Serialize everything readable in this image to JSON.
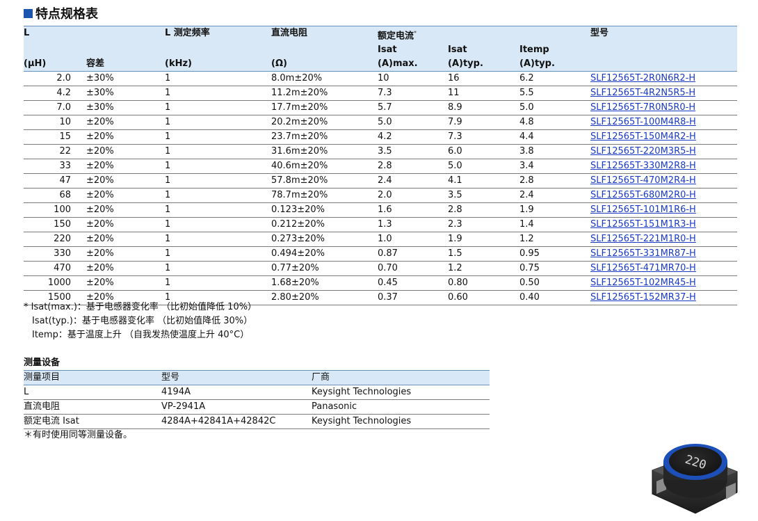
{
  "title": "特点规格表",
  "spec_table": {
    "headers": {
      "L_top": "L",
      "freq": "L 测定频率",
      "dcr": "直流电阻",
      "rated": "额定电流",
      "rated_mark": "*",
      "part": "型号",
      "isat_max_top": "Isat",
      "isat_typ_top": "Isat",
      "itemp_top": "Itemp",
      "L_unit": "(μH)",
      "tol": "容差",
      "freq_unit": "(kHz)",
      "dcr_unit": "(Ω)",
      "isat_max_unit": "(A)max.",
      "isat_typ_unit": "(A)typ.",
      "itemp_unit": "(A)typ."
    },
    "rows": [
      {
        "l": "2.0",
        "tol": "±30%",
        "freq": "1",
        "dcr": "8.0m±20%",
        "isat_max": "10",
        "isat_typ": "16",
        "itemp": "6.2",
        "part": "SLF12565T-2R0N6R2-H"
      },
      {
        "l": "4.2",
        "tol": "±30%",
        "freq": "1",
        "dcr": "11.2m±20%",
        "isat_max": "7.3",
        "isat_typ": "11",
        "itemp": "5.5",
        "part": "SLF12565T-4R2N5R5-H"
      },
      {
        "l": "7.0",
        "tol": "±30%",
        "freq": "1",
        "dcr": "17.7m±20%",
        "isat_max": "5.7",
        "isat_typ": "8.9",
        "itemp": "5.0",
        "part": "SLF12565T-7R0N5R0-H"
      },
      {
        "l": "10",
        "tol": "±20%",
        "freq": "1",
        "dcr": "20.2m±20%",
        "isat_max": "5.0",
        "isat_typ": "7.9",
        "itemp": "4.8",
        "part": "SLF12565T-100M4R8-H"
      },
      {
        "l": "15",
        "tol": "±20%",
        "freq": "1",
        "dcr": "23.7m±20%",
        "isat_max": "4.2",
        "isat_typ": "7.3",
        "itemp": "4.4",
        "part": "SLF12565T-150M4R2-H"
      },
      {
        "l": "22",
        "tol": "±20%",
        "freq": "1",
        "dcr": "31.6m±20%",
        "isat_max": "3.5",
        "isat_typ": "6.0",
        "itemp": "3.8",
        "part": "SLF12565T-220M3R5-H"
      },
      {
        "l": "33",
        "tol": "±20%",
        "freq": "1",
        "dcr": "40.6m±20%",
        "isat_max": "2.8",
        "isat_typ": "5.0",
        "itemp": "3.4",
        "part": "SLF12565T-330M2R8-H"
      },
      {
        "l": "47",
        "tol": "±20%",
        "freq": "1",
        "dcr": "57.8m±20%",
        "isat_max": "2.4",
        "isat_typ": "4.1",
        "itemp": "2.8",
        "part": "SLF12565T-470M2R4-H"
      },
      {
        "l": "68",
        "tol": "±20%",
        "freq": "1",
        "dcr": "78.7m±20%",
        "isat_max": "2.0",
        "isat_typ": "3.5",
        "itemp": "2.4",
        "part": "SLF12565T-680M2R0-H"
      },
      {
        "l": "100",
        "tol": "±20%",
        "freq": "1",
        "dcr": "0.123±20%",
        "isat_max": "1.6",
        "isat_typ": "2.8",
        "itemp": "1.9",
        "part": "SLF12565T-101M1R6-H"
      },
      {
        "l": "150",
        "tol": "±20%",
        "freq": "1",
        "dcr": "0.212±20%",
        "isat_max": "1.3",
        "isat_typ": "2.3",
        "itemp": "1.4",
        "part": "SLF12565T-151M1R3-H"
      },
      {
        "l": "220",
        "tol": "±20%",
        "freq": "1",
        "dcr": "0.273±20%",
        "isat_max": "1.0",
        "isat_typ": "1.9",
        "itemp": "1.2",
        "part": "SLF12565T-221M1R0-H"
      },
      {
        "l": "330",
        "tol": "±20%",
        "freq": "1",
        "dcr": "0.494±20%",
        "isat_max": "0.87",
        "isat_typ": "1.5",
        "itemp": "0.95",
        "part": "SLF12565T-331MR87-H"
      },
      {
        "l": "470",
        "tol": "±20%",
        "freq": "1",
        "dcr": "0.77±20%",
        "isat_max": "0.70",
        "isat_typ": "1.2",
        "itemp": "0.75",
        "part": "SLF12565T-471MR70-H"
      },
      {
        "l": "1000",
        "tol": "±20%",
        "freq": "1",
        "dcr": "1.68±20%",
        "isat_max": "0.45",
        "isat_typ": "0.80",
        "itemp": "0.50",
        "part": "SLF12565T-102MR45-H"
      },
      {
        "l": "1500",
        "tol": "±20%",
        "freq": "1",
        "dcr": "2.80±20%",
        "isat_max": "0.37",
        "isat_typ": "0.60",
        "itemp": "0.40",
        "part": "SLF12565T-152MR37-H"
      }
    ]
  },
  "notes": [
    "* Isat(max.)：基于电感器变化率 （比初始值降低 10%）",
    "Isat(typ.)：基于电感器变化率 （比初始值降低 30%）",
    "Itemp：基于温度上升 （自我发热使温度上升 40°C）"
  ],
  "equipment": {
    "title": "测量设备",
    "headers": [
      "测量项目",
      "型号",
      "厂商"
    ],
    "rows": [
      [
        "L",
        "4194A",
        "Keysight Technologies"
      ],
      [
        "直流电阻",
        "VP-2941A",
        "Panasonic"
      ],
      [
        "额定电流 Isat",
        "4284A+42841A+42842C",
        "Keysight Technologies"
      ]
    ],
    "note": "＊有时使用同等测量设备。"
  },
  "photo": {
    "marking": "220",
    "colors": {
      "body": "#3a3a3a",
      "ring": "#1c4fb8",
      "top": "#1e1e1e"
    }
  }
}
